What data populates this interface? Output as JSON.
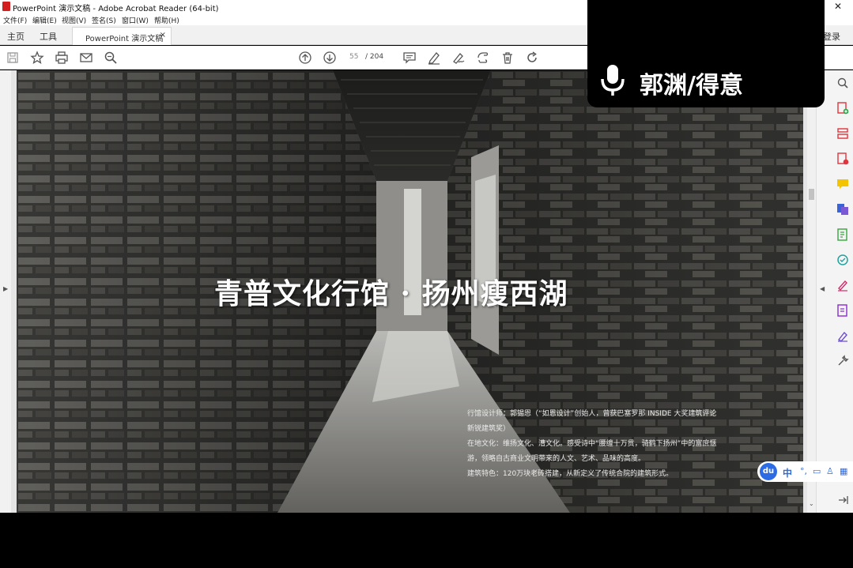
{
  "window": {
    "title": "PowerPoint 演示文稿 - Adobe Acrobat Reader (64-bit)"
  },
  "menu": [
    "文件(F)",
    "编辑(E)",
    "视图(V)",
    "签名(S)",
    "窗口(W)",
    "帮助(H)"
  ],
  "tabs": {
    "home": "主页",
    "tools": "工具",
    "document": "PowerPoint 演示文稿",
    "close": "×",
    "login": "登录"
  },
  "toolbar": {
    "page_current": "55",
    "page_separator": "/ 204"
  },
  "slide": {
    "title": "青普文化行馆 · 扬州瘦西湖",
    "caption": [
      "行馆设计师：郭锡恩（“如恩设计”创始人，曾获巴塞罗那 INSIDE 大奖建筑评论",
      "新锐建筑奖）",
      "在地文化：维扬文化、漕文化。感受诗中“腰缠十万贯，骑鹤下扬州”中的富庶惬",
      "游，领略自古商业文明带来的人文、艺术、品味的高度。",
      "建筑特色：120万块老砖搭建，从新定义了传统合院的建筑形式。"
    ]
  },
  "voice": {
    "speaker": "郭渊/得意"
  },
  "ime": {
    "logo": "du",
    "mode": "中",
    "punct": "°,",
    "glyphs": [
      "▭",
      "♙",
      "▦"
    ]
  },
  "colors": {
    "accent_red": "#d21f1f",
    "ime_blue": "#2d6be4"
  }
}
